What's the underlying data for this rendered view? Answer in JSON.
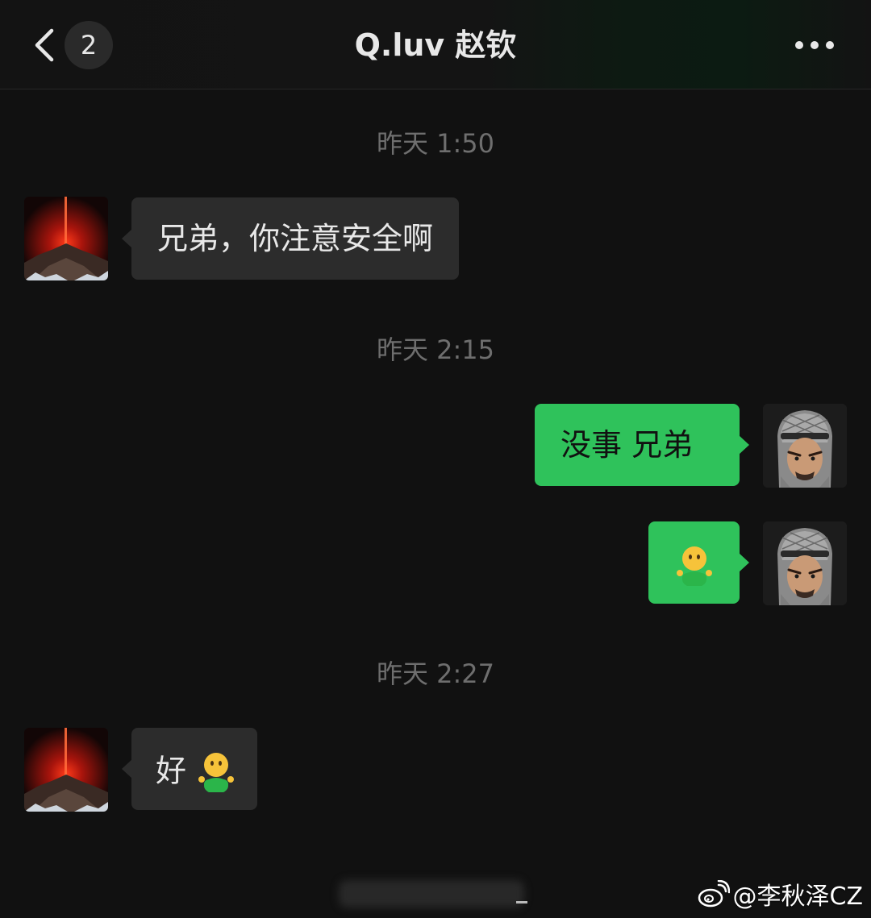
{
  "header": {
    "title": "Q.luv 赵钦",
    "unread_count": "2",
    "back_icon": "chevron-left-icon",
    "more_icon": "more-dots-icon"
  },
  "messages": [
    {
      "type": "timestamp",
      "text": "昨天 1:50"
    },
    {
      "type": "incoming",
      "text": "兄弟，你注意安全啊",
      "avatar": "volcano-avatar"
    },
    {
      "type": "timestamp",
      "text": "昨天 2:15"
    },
    {
      "type": "outgoing",
      "text": "没事 兄弟",
      "avatar": "memoji-avatar"
    },
    {
      "type": "outgoing",
      "text": "",
      "emoji": "shrug-person-emoji",
      "avatar": "memoji-avatar"
    },
    {
      "type": "timestamp",
      "text": "昨天 2:27"
    },
    {
      "type": "incoming",
      "text": "好",
      "emoji": "shrug-person-emoji",
      "avatar": "volcano-avatar"
    }
  ],
  "watermark": {
    "text": "@李秋泽CZ",
    "icon": "weibo-icon"
  },
  "colors": {
    "background": "#111111",
    "incoming_bubble": "#2c2c2c",
    "outgoing_bubble": "#2fc25b",
    "timestamp": "#6e6e6e",
    "text": "#e8e8e8"
  }
}
